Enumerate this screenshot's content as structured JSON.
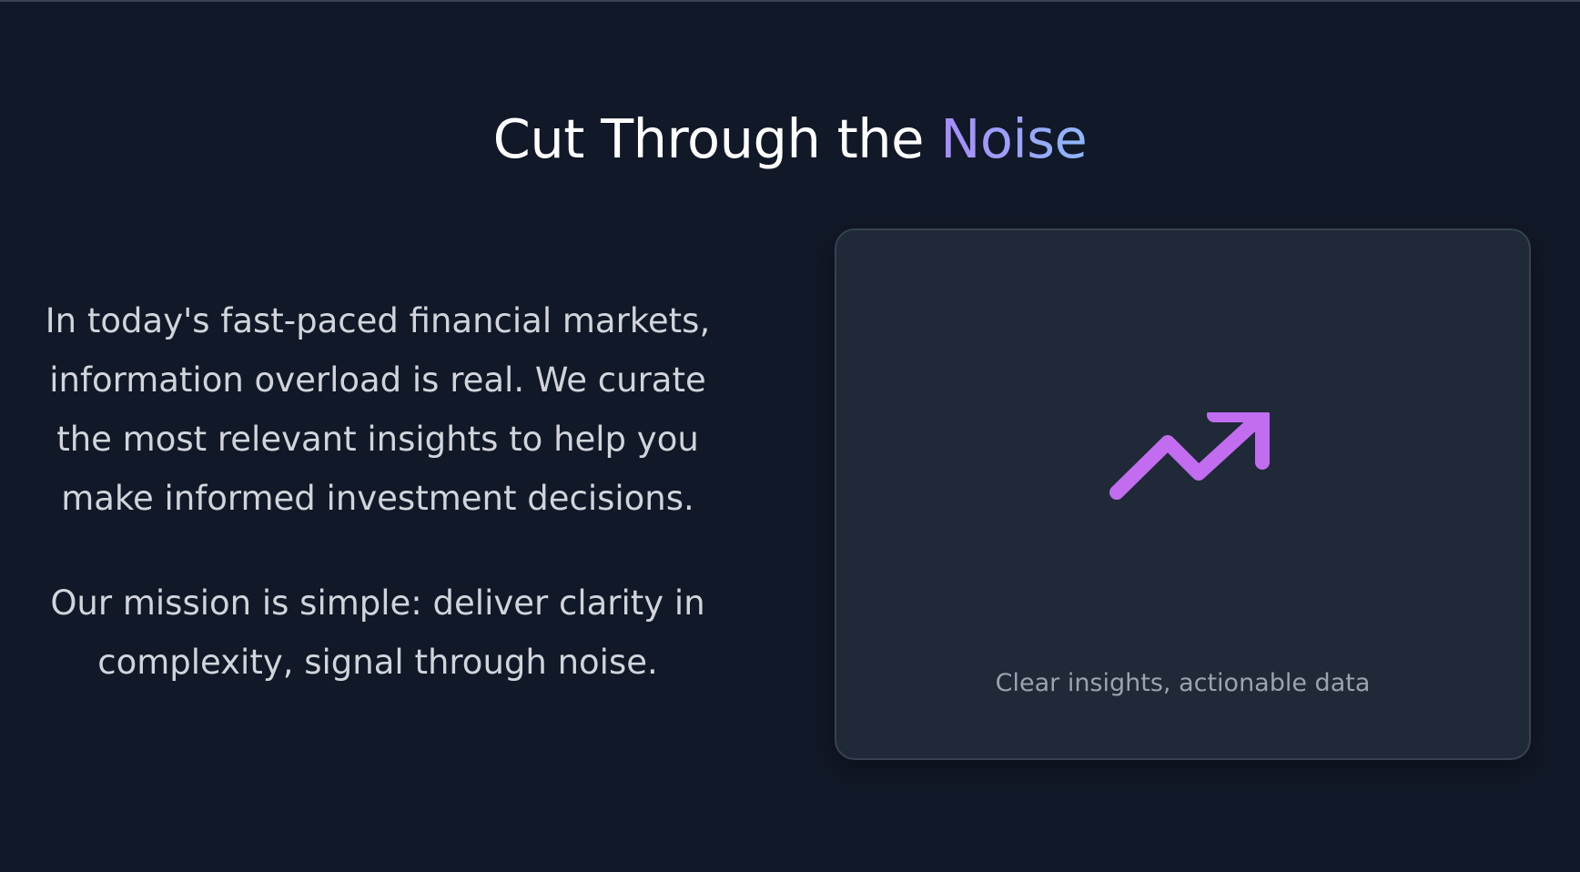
{
  "hero": {
    "title_main": "Cut Through the ",
    "title_accent": "Noise"
  },
  "content": {
    "paragraph_1": "In today's fast-paced financial markets, information overload is real. We curate the most relevant insights to help you make informed investment decisions.",
    "paragraph_2": "Our mission is simple: deliver clarity in complexity, signal through noise."
  },
  "card": {
    "icon": "trending-up-icon",
    "caption": "Clear insights, actionable data"
  },
  "colors": {
    "background": "#111827",
    "card": "#1f2937",
    "icon": "#c26cf0",
    "accent_start": "#a78bfa",
    "accent_end": "#8fb8fb"
  }
}
